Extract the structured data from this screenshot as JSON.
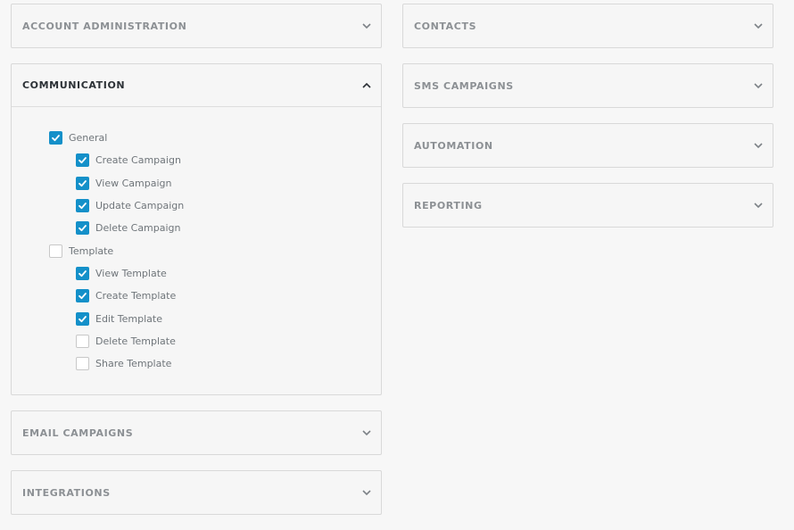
{
  "colors": {
    "accent": "#1490c9",
    "panel_border": "#d9d9d9",
    "title_muted": "#8c9094",
    "title_active": "#2c3136"
  },
  "left_panels": {
    "account_administration": {
      "title": "ACCOUNT ADMINISTRATION",
      "expanded": false,
      "icon": "chevron-down-icon"
    },
    "communication": {
      "title": "COMMUNICATION",
      "expanded": true,
      "icon": "chevron-up-icon",
      "permissions": [
        {
          "label": "General",
          "level": 1,
          "checked": true
        },
        {
          "label": "Create Campaign",
          "level": 2,
          "checked": true
        },
        {
          "label": "View Campaign",
          "level": 2,
          "checked": true
        },
        {
          "label": "Update Campaign",
          "level": 2,
          "checked": true
        },
        {
          "label": "Delete Campaign",
          "level": 2,
          "checked": true
        },
        {
          "label": "Template",
          "level": 1,
          "checked": false
        },
        {
          "label": "View Template",
          "level": 2,
          "checked": true
        },
        {
          "label": "Create Template",
          "level": 2,
          "checked": true
        },
        {
          "label": "Edit Template",
          "level": 2,
          "checked": true
        },
        {
          "label": "Delete Template",
          "level": 2,
          "checked": false
        },
        {
          "label": "Share Template",
          "level": 2,
          "checked": false
        }
      ]
    },
    "email_campaigns": {
      "title": "EMAIL CAMPAIGNS",
      "expanded": false,
      "icon": "chevron-down-icon"
    },
    "integrations": {
      "title": "INTEGRATIONS",
      "expanded": false,
      "icon": "chevron-down-icon"
    }
  },
  "right_panels": {
    "contacts": {
      "title": "CONTACTS",
      "expanded": false,
      "icon": "chevron-down-icon"
    },
    "sms_campaigns": {
      "title": "SMS CAMPAIGNS",
      "expanded": false,
      "icon": "chevron-down-icon"
    },
    "automation": {
      "title": "AUTOMATION",
      "expanded": false,
      "icon": "chevron-down-icon"
    },
    "reporting": {
      "title": "REPORTING",
      "expanded": false,
      "icon": "chevron-down-icon"
    }
  }
}
